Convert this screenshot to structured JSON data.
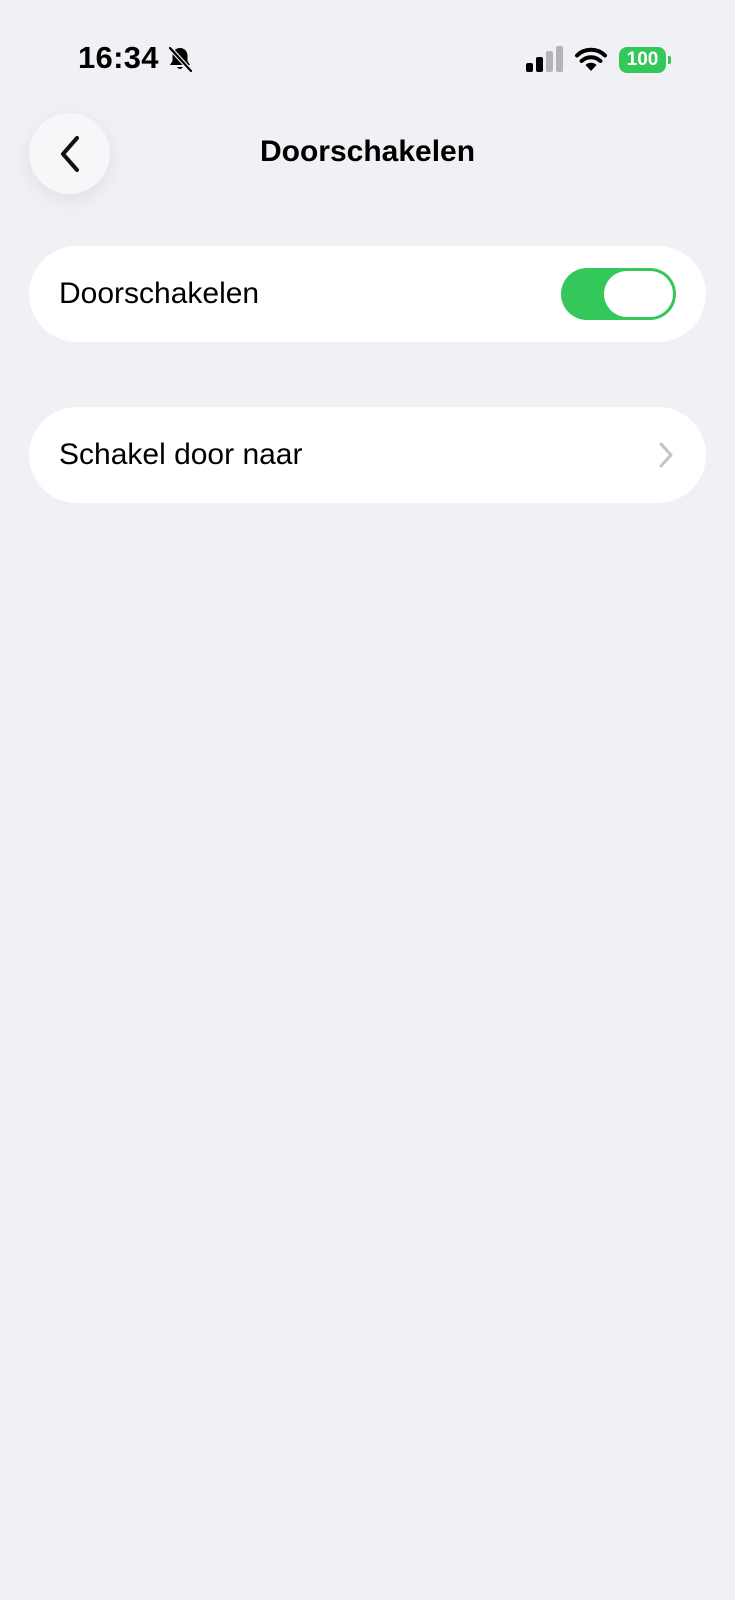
{
  "status_bar": {
    "time": "16:34",
    "battery_level": "100",
    "icons": [
      "bell-slash-icon",
      "cellular-signal-icon",
      "wifi-icon",
      "battery-icon"
    ]
  },
  "nav": {
    "title": "Doorschakelen",
    "back_icon": "chevron-left-icon"
  },
  "settings": {
    "forwarding": {
      "label": "Doorschakelen",
      "enabled": true
    },
    "forward_to": {
      "label": "Schakel door naar",
      "icon": "chevron-right-icon"
    }
  },
  "colors": {
    "background": "#f0f0f5",
    "accent": "#34c759",
    "card": "#ffffff",
    "chevron": "#c4c4c7"
  }
}
